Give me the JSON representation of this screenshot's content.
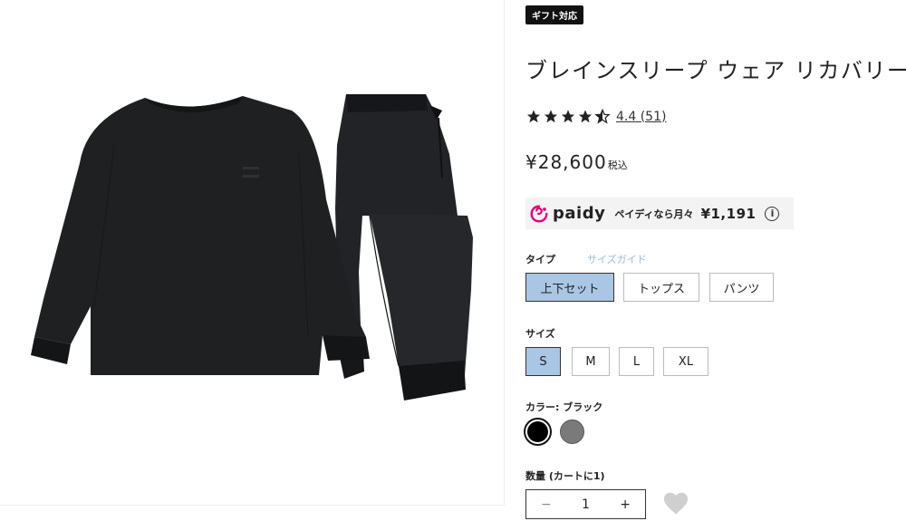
{
  "badge": "ギフト対応",
  "product": {
    "title": "ブレインスリープ ウェア リカバリー",
    "rating_text": "4.4 (51)",
    "rating_value": 4.4,
    "price": "¥28,600",
    "tax_label": "税込"
  },
  "paidy": {
    "logo_text": "paidy",
    "text": "ペイディなら月々",
    "amount": "¥1,191",
    "info": "i",
    "brand_color": "#e5007e"
  },
  "type_option": {
    "label": "タイプ",
    "size_guide": "サイズガイド",
    "options": [
      "上下セット",
      "トップス",
      "パンツ"
    ],
    "selected": "上下セット"
  },
  "size_option": {
    "label": "サイズ",
    "options": [
      "S",
      "M",
      "L",
      "XL"
    ],
    "selected": "S"
  },
  "color_option": {
    "label": "カラー: ブラック",
    "swatches": [
      {
        "name": "ブラック",
        "color": "#000000",
        "selected": true
      },
      {
        "name": "グレー",
        "color": "#7a7a7a",
        "selected": false
      }
    ]
  },
  "quantity": {
    "label": "数量 (カートに1)",
    "minus": "−",
    "value": "1",
    "plus": "+"
  },
  "colors": {
    "selected_option": "#a9c6e4",
    "badge_bg": "#111111",
    "garment": "#1c1d1f"
  }
}
